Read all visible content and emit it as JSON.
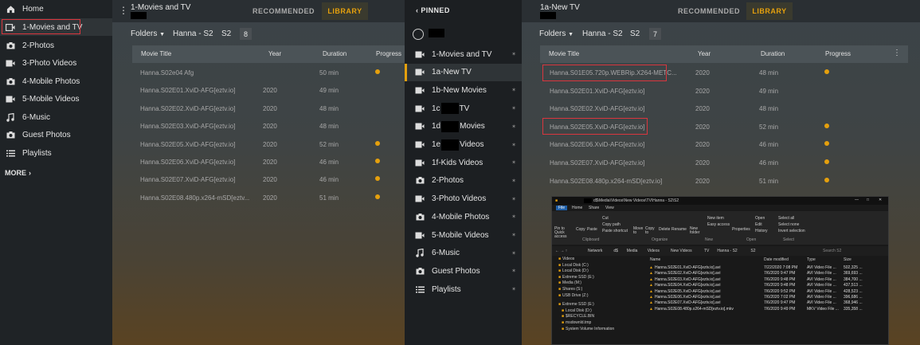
{
  "sidebar": {
    "items": [
      {
        "label": "Home",
        "icon": "home-icon"
      },
      {
        "label": "1-Movies and TV",
        "icon": "tv-icon"
      },
      {
        "label": "2-Photos",
        "icon": "camera-icon"
      },
      {
        "label": "3-Photo Videos",
        "icon": "video-icon"
      },
      {
        "label": "4-Mobile Photos",
        "icon": "camera-icon"
      },
      {
        "label": "5-Mobile Videos",
        "icon": "video-icon"
      },
      {
        "label": "6-Music",
        "icon": "music-icon"
      },
      {
        "label": "Guest Photos",
        "icon": "camera-icon"
      },
      {
        "label": "Playlists",
        "icon": "list-icon"
      }
    ],
    "more_label": "MORE"
  },
  "panel1": {
    "title": "1-Movies and TV",
    "tab_recommended": "RECOMMENDED",
    "tab_library": "LIBRARY",
    "folders_label": "Folders",
    "breadcrumb": "Hanna - S2",
    "season": "S2",
    "count": "8",
    "columns": {
      "title": "Movie Title",
      "year": "Year",
      "duration": "Duration",
      "progress": "Progress"
    },
    "rows": [
      {
        "title": "Hanna.S02e04 Afg",
        "year": "",
        "duration": "50 min",
        "progress": true
      },
      {
        "title": "Hanna.S02E01.XviD-AFG[eztv.io]",
        "year": "2020",
        "duration": "49 min",
        "progress": false
      },
      {
        "title": "Hanna.S02E02.XviD-AFG[eztv.io]",
        "year": "2020",
        "duration": "48 min",
        "progress": false
      },
      {
        "title": "Hanna.S02E03.XviD-AFG[eztv.io]",
        "year": "2020",
        "duration": "48 min",
        "progress": false
      },
      {
        "title": "Hanna.S02E05.XviD-AFG[eztv.io]",
        "year": "2020",
        "duration": "52 min",
        "progress": true
      },
      {
        "title": "Hanna.S02E06.XviD-AFG[eztv.io]",
        "year": "2020",
        "duration": "46 min",
        "progress": true
      },
      {
        "title": "Hanna.S02E07.XviD-AFG[eztv.io]",
        "year": "2020",
        "duration": "46 min",
        "progress": true
      },
      {
        "title": "Hanna.S02E08.480p.x264-mSD[eztv...",
        "year": "2020",
        "duration": "51 min",
        "progress": true
      }
    ]
  },
  "pinned": {
    "back_label": "PINNED",
    "items": [
      {
        "label": "1-Movies and TV",
        "icon": "tv-icon"
      },
      {
        "label": "1a-New TV",
        "icon": "tv-icon"
      },
      {
        "label": "1b-New Movies",
        "icon": "tv-icon"
      },
      {
        "label": "1c",
        "suffix": "TV",
        "icon": "tv-icon"
      },
      {
        "label": "1d",
        "suffix": "Movies",
        "icon": "tv-icon"
      },
      {
        "label": "1e",
        "suffix": "Videos",
        "icon": "video-icon"
      },
      {
        "label": "1f-Kids Videos",
        "icon": "video-icon"
      },
      {
        "label": "2-Photos",
        "icon": "camera-icon"
      },
      {
        "label": "3-Photo Videos",
        "icon": "video-icon"
      },
      {
        "label": "4-Mobile Photos",
        "icon": "camera-icon"
      },
      {
        "label": "5-Mobile Videos",
        "icon": "video-icon"
      },
      {
        "label": "6-Music",
        "icon": "music-icon"
      },
      {
        "label": "Guest Photos",
        "icon": "camera-icon"
      },
      {
        "label": "Playlists",
        "icon": "list-icon"
      }
    ]
  },
  "panel3": {
    "title": "1a-New TV",
    "tab_recommended": "RECOMMENDED",
    "tab_library": "LIBRARY",
    "folders_label": "Folders",
    "breadcrumb": "Hanna - S2",
    "season": "S2",
    "count": "7",
    "columns": {
      "title": "Movie Title",
      "year": "Year",
      "duration": "Duration",
      "progress": "Progress"
    },
    "rows": [
      {
        "title": "Hanna.S01E05.720p.WEBRip.X264-METC...",
        "year": "2020",
        "duration": "48 min",
        "progress": true
      },
      {
        "title": "Hanna.S02E01.XviD-AFG[eztv.io]",
        "year": "2020",
        "duration": "49 min",
        "progress": false
      },
      {
        "title": "Hanna.S02E02.XviD-AFG[eztv.io]",
        "year": "2020",
        "duration": "48 min",
        "progress": false
      },
      {
        "title": "Hanna.S02E05.XviD-AFG[eztv.io]",
        "year": "2020",
        "duration": "52 min",
        "progress": true
      },
      {
        "title": "Hanna.S02E06.XviD-AFG[eztv.io]",
        "year": "2020",
        "duration": "46 min",
        "progress": true
      },
      {
        "title": "Hanna.S02E07.XviD-AFG[eztv.io]",
        "year": "2020",
        "duration": "46 min",
        "progress": true
      },
      {
        "title": "Hanna.S02E08.480p.x264-mSD[eztv.io]",
        "year": "2020",
        "duration": "51 min",
        "progress": true
      }
    ]
  },
  "explorer": {
    "path_title": "d$\\Media\\Videos\\New Videos\\TV\\Hanna - S2\\S2",
    "tabs": [
      "File",
      "Home",
      "Share",
      "View"
    ],
    "ribbon": {
      "pin": "Pin to Quick access",
      "copy": "Copy",
      "paste": "Paste",
      "cut": "Cut",
      "copy_path": "Copy path",
      "paste_shortcut": "Paste shortcut",
      "move_to": "Move to",
      "copy_to": "Copy to",
      "delete": "Delete",
      "rename": "Rename",
      "new_folder": "New folder",
      "new_item": "New item",
      "easy_access": "Easy access",
      "properties": "Properties",
      "open": "Open",
      "edit": "Edit",
      "history": "History",
      "select_all": "Select all",
      "select_none": "Select none",
      "invert_selection": "Invert selection",
      "group_clipboard": "Clipboard",
      "group_organize": "Organize",
      "group_new": "New",
      "group_open": "Open",
      "group_select": "Select"
    },
    "breadcrumb": [
      "Network",
      "d$",
      "Media",
      "Videos",
      "New Videos",
      "TV",
      "Hanna - S2",
      "S2"
    ],
    "search_placeholder": "Search S2",
    "tree": [
      "Videos",
      "Local Disk (C:)",
      "Local Disk (D:)",
      "Extreme SSD (E:)",
      "Media (M:)",
      "Shares (S:)",
      "USB Drive (Z:)",
      "Extreme SSD (E:)",
      "Local Disk (D:)",
      "$RECYCLE.BIN",
      "msdownld.tmp",
      "System Volume Information"
    ],
    "columns": {
      "name": "Name",
      "date": "Date modified",
      "type": "Type",
      "size": "Size"
    },
    "files": [
      {
        "name": "Hanna.S02E01.XviD-AFG[eztv.io].avi",
        "date": "7/22/2020 7:08 PM",
        "type": "AVI Video File ...",
        "size": "502,325 ..."
      },
      {
        "name": "Hanna.S02E02.XviD-AFG[eztv.io].avi",
        "date": "7/6/2020 9:47 PM",
        "type": "AVI Video File ...",
        "size": "369,693 ..."
      },
      {
        "name": "Hanna.S02E03.XviD-AFG[eztv.io].avi",
        "date": "7/6/2020 9:48 PM",
        "type": "AVI Video File ...",
        "size": "384,700 ..."
      },
      {
        "name": "Hanna.S02E04.XviD-AFG[eztv.io].avi",
        "date": "7/6/2020 9:48 PM",
        "type": "AVI Video File ...",
        "size": "437,513 ..."
      },
      {
        "name": "Hanna.S02E05.XviD-AFG[eztv.io].avi",
        "date": "7/6/2020 9:52 PM",
        "type": "AVI Video File ...",
        "size": "428,523 ..."
      },
      {
        "name": "Hanna.S02E06.XviD-AFG[eztv.io].avi",
        "date": "7/6/2020 7:02 PM",
        "type": "AVI Video File ...",
        "size": "396,686 ..."
      },
      {
        "name": "Hanna.S02E07.XviD-AFG[eztv.io].avi",
        "date": "7/6/2020 9:47 PM",
        "type": "AVI Video File ...",
        "size": "368,946 ..."
      },
      {
        "name": "Hanna.S02E08.480p.x264-mSD[eztv.io].mkv",
        "date": "7/6/2020 9:49 PM",
        "type": "MKV Video File ...",
        "size": "335,358 ..."
      }
    ]
  },
  "colors": {
    "accent": "#e5a00d",
    "highlight": "#d9363e"
  }
}
